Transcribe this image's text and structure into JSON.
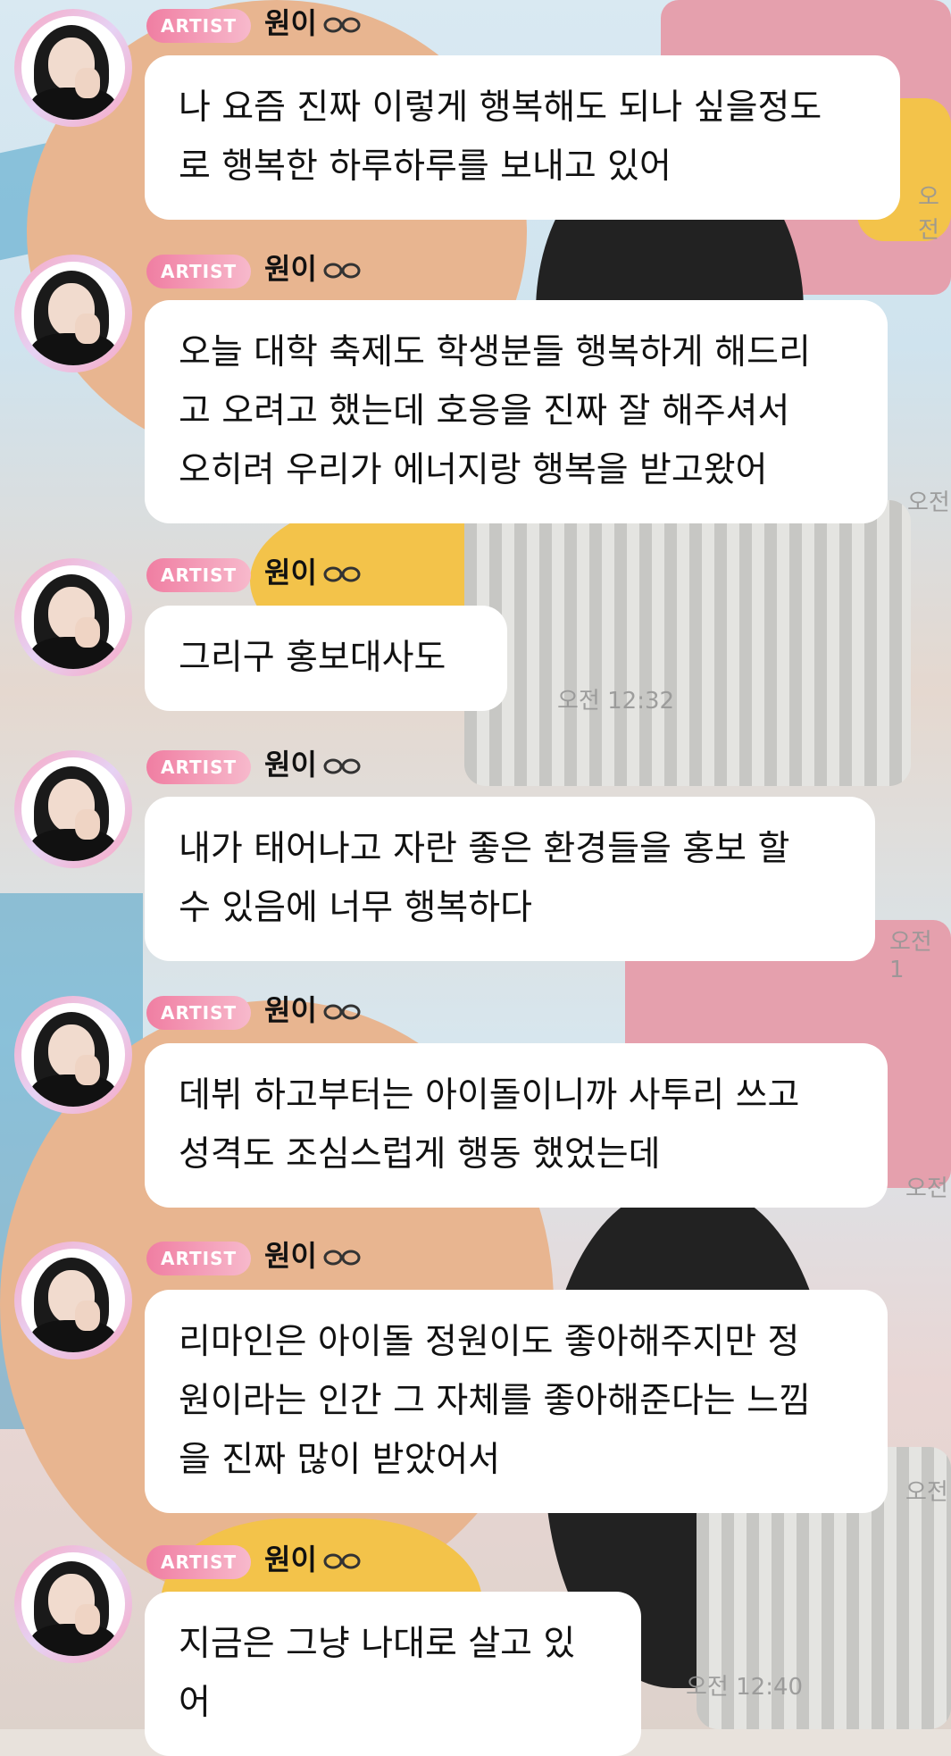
{
  "sender": {
    "badge": "ARTIST",
    "name": "원이"
  },
  "messages": [
    {
      "text": "나 요즘 진짜 이렇게 행복해도 되나 싶을정도\n로 행복한 하루하루를 보내고 있어",
      "time": "오전"
    },
    {
      "text": "오늘 대학 축제도 학생분들 행복하게 해드리\n고 오려고 했는데 호응을 진짜 잘 해주셔서\n오히려 우리가 에너지랑 행복을 받고왔어",
      "time": "오전"
    },
    {
      "text": "그리구 홍보대사도",
      "time": "오전 12:32"
    },
    {
      "text": "내가 태어나고 자란 좋은 환경들을 홍보 할\n수 있음에 너무 행복하다",
      "time": "오전 1"
    },
    {
      "text": "데뷔 하고부터는 아이돌이니까 사투리 쓰고\n성격도 조심스럽게 행동 했었는데",
      "time": "오전"
    },
    {
      "text": "리마인은 아이돌 정원이도 좋아해주지만 정\n원이라는 인간 그 자체를 좋아해준다는 느낌\n을 진짜 많이 받았어서",
      "time": "오전"
    },
    {
      "text": "지금은 그냥 나대로 살고 있어",
      "time": "오전 12:40"
    }
  ],
  "icons": {
    "name_suffix": "infinity-loop-icon",
    "avatar": "profile-photo"
  },
  "colors": {
    "badge_start": "#f07ea2",
    "badge_end": "#f7b9cc",
    "bubble": "#ffffff",
    "ring": "#f7a8c4"
  }
}
